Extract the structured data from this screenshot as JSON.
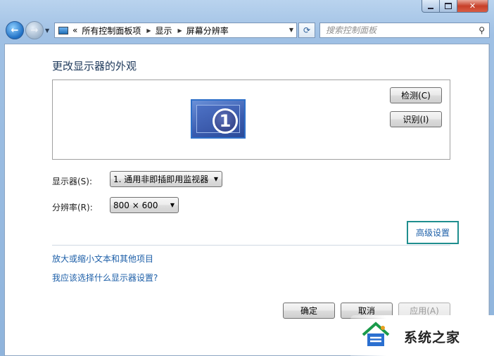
{
  "address_bar": {
    "overflow_glyph": "«",
    "crumbs": [
      "所有控制面板项",
      "显示",
      "屏幕分辨率"
    ]
  },
  "search": {
    "placeholder": "搜索控制面板"
  },
  "page": {
    "title": "更改显示器的外观",
    "monitor_number": "1",
    "detect_label": "检测(C)",
    "identify_label": "识别(I)",
    "display_label": "显示器(S):",
    "display_value": "1. 通用非即插即用监视器",
    "resolution_label": "分辨率(R):",
    "resolution_value": "800 × 600",
    "advanced_link": "高级设置",
    "link_text_size": "放大或缩小文本和其他项目",
    "link_which_settings": "我应该选择什么显示器设置?",
    "ok_label": "确定",
    "cancel_label": "取消",
    "apply_label": "应用(A)"
  },
  "watermark": {
    "text": "系统之家"
  },
  "colors": {
    "link": "#1d5fa8",
    "highlight_border": "#1f8e8e",
    "title": "#1e395b"
  }
}
